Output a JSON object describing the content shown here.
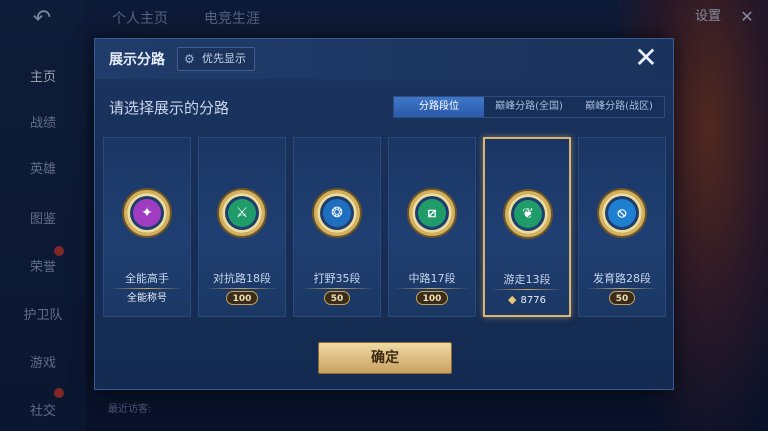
{
  "nav": {
    "back_icon": "back-arrow-icon",
    "sidebar": [
      {
        "label": "主页",
        "active": true
      },
      {
        "label": "战绩"
      },
      {
        "label": "英雄"
      },
      {
        "label": "图鉴"
      },
      {
        "label": "荣誉"
      },
      {
        "label": "护卫队"
      },
      {
        "label": "游戏"
      },
      {
        "label": "社交"
      }
    ],
    "top_tabs": [
      "个人主页",
      "电竞生涯"
    ],
    "settings_label": "设置",
    "recent_label": "最近访客:"
  },
  "modal": {
    "title": "展示分路",
    "priority_label": "优先显示",
    "close_icon": "close-x-icon",
    "subtitle": "请选择展示的分路",
    "tabs": [
      {
        "label": "分路段位",
        "active": true
      },
      {
        "label": "巅峰分路(全国)"
      },
      {
        "label": "巅峰分路(战区)"
      }
    ],
    "cards": [
      {
        "label": "全能高手",
        "footer": "全能称号",
        "emblem_color": "#a03cc2",
        "icon": "all-rounder-emblem-icon"
      },
      {
        "label": "对抗路18段",
        "badge": "100",
        "emblem_color": "#1f9c6a",
        "icon": "clash-lane-emblem-icon"
      },
      {
        "label": "打野35段",
        "badge": "50",
        "emblem_color": "#1f6fc0",
        "icon": "jungle-emblem-icon"
      },
      {
        "label": "中路17段",
        "badge": "100",
        "emblem_color": "#1f9c6a",
        "icon": "mid-lane-emblem-icon"
      },
      {
        "label": "游走13段",
        "points": "8776",
        "emblem_color": "#1f9c6a",
        "icon": "roam-emblem-icon",
        "selected": true
      },
      {
        "label": "发育路28段",
        "badge": "50",
        "emblem_color": "#1f7fd0",
        "icon": "farm-lane-emblem-icon"
      }
    ],
    "confirm_label": "确定"
  },
  "colors": {
    "accent_gold": "#d6b15c",
    "tab_active": "#2a5aa8",
    "panel": "#17305a"
  }
}
